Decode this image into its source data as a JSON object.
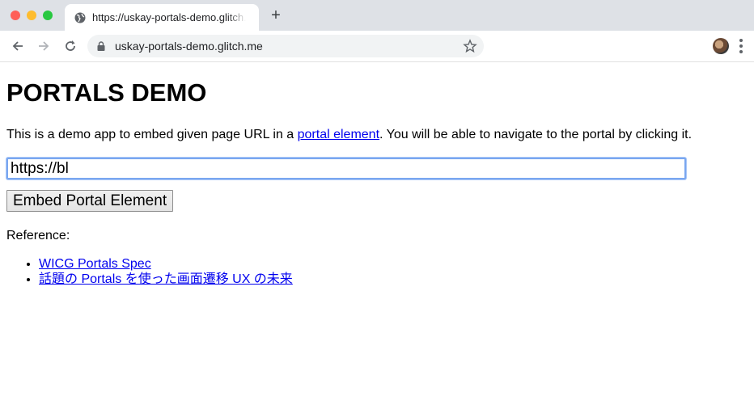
{
  "browser": {
    "tab_title": "https://uskay-portals-demo.glitch.me",
    "new_tab_label": "+",
    "url": "uskay-portals-demo.glitch.me"
  },
  "page": {
    "heading": "PORTALS DEMO",
    "intro_before": "This is a demo app to embed given page URL in a ",
    "intro_link": "portal element",
    "intro_after": ". You will be able to navigate to the portal by clicking it.",
    "input_value": "https://bl",
    "button_label": "Embed Portal Element",
    "reference_label": "Reference:",
    "references": [
      {
        "label": "WICG Portals Spec"
      },
      {
        "label": "話題の Portals を使った画面遷移 UX の未来"
      }
    ]
  },
  "colors": {
    "link": "#0000ee",
    "chrome_bg": "#dee1e6",
    "focus_ring": "#7aa7f0"
  }
}
